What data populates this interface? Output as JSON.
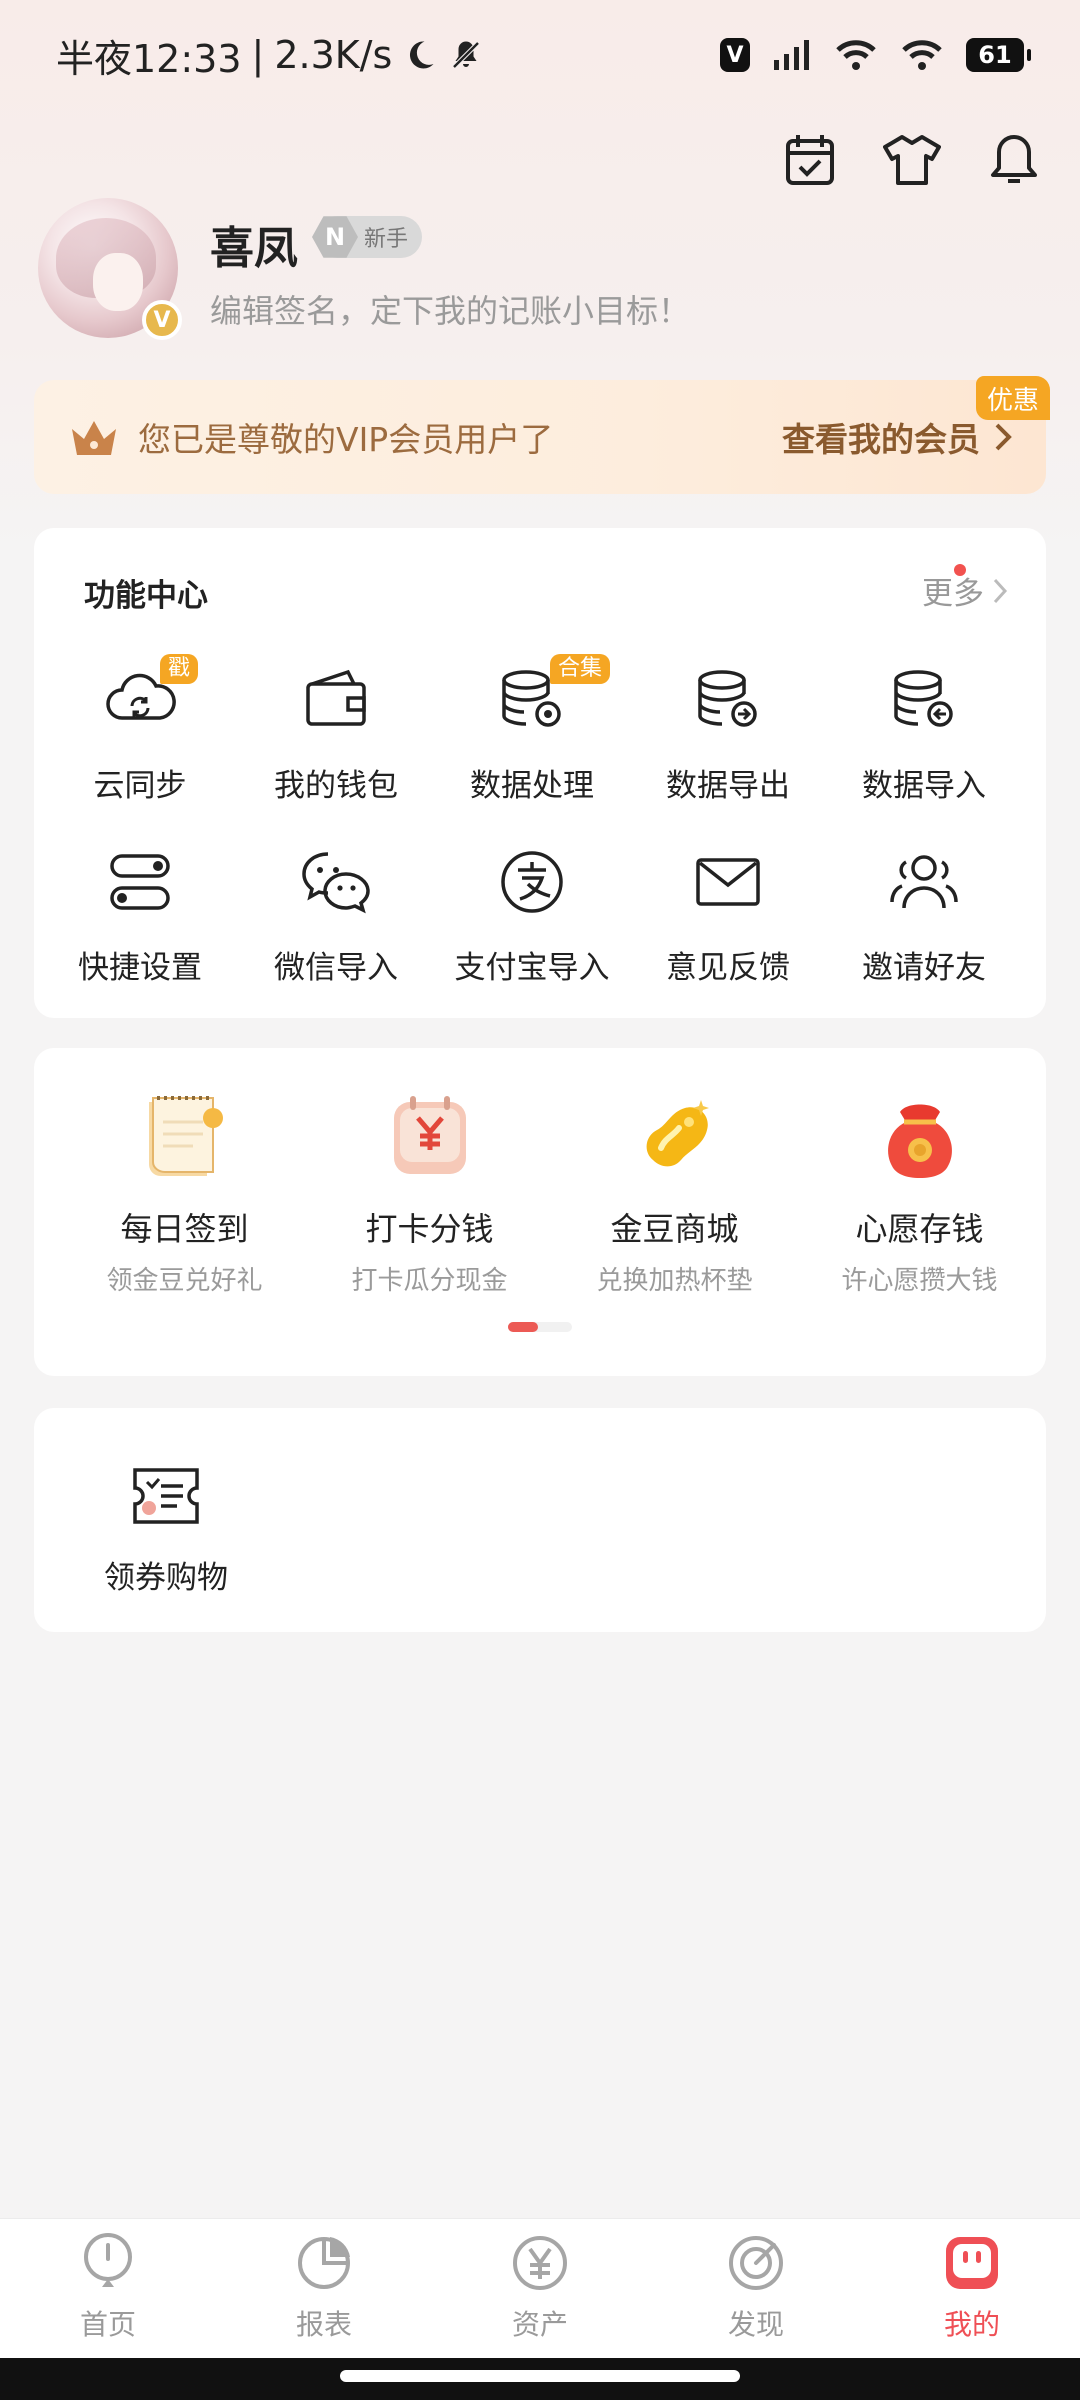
{
  "status_bar": {
    "time": "半夜12:33",
    "separator": "|",
    "speed": "2.3K/s",
    "vpn": "V",
    "battery": "61"
  },
  "header": {
    "icons": [
      "calendar-check-icon",
      "shirt-icon",
      "bell-icon"
    ]
  },
  "profile": {
    "username": "喜凤",
    "level_letter": "N",
    "level_label": "新手",
    "avatar_badge": "V",
    "signature": "编辑签名，定下我的记账小目标！"
  },
  "vip": {
    "text": "您已是尊敬的VIP会员用户了",
    "link": "查看我的会员",
    "promo_badge": "优惠",
    "accent": "#f5a623"
  },
  "function_center": {
    "title": "功能中心",
    "more": "更多",
    "items": [
      {
        "label": "云同步",
        "badge": "戳"
      },
      {
        "label": "我的钱包",
        "badge": ""
      },
      {
        "label": "数据处理",
        "badge": "合集"
      },
      {
        "label": "数据导出",
        "badge": ""
      },
      {
        "label": "数据导入",
        "badge": ""
      },
      {
        "label": "快捷设置",
        "badge": ""
      },
      {
        "label": "微信导入",
        "badge": ""
      },
      {
        "label": "支付宝导入",
        "badge": ""
      },
      {
        "label": "意见反馈",
        "badge": ""
      },
      {
        "label": "邀请好友",
        "badge": ""
      }
    ]
  },
  "activities": {
    "items": [
      {
        "label": "每日签到",
        "sub": "领金豆兑好礼"
      },
      {
        "label": "打卡分钱",
        "sub": "打卡瓜分现金"
      },
      {
        "label": "金豆商城",
        "sub": "兑换加热杯垫"
      },
      {
        "label": "心愿存钱",
        "sub": "许心愿攒大钱"
      }
    ]
  },
  "coupon": {
    "label": "领券购物"
  },
  "bottom_nav": {
    "items": [
      {
        "label": "首页"
      },
      {
        "label": "报表"
      },
      {
        "label": "资产"
      },
      {
        "label": "发现"
      },
      {
        "label": "我的"
      }
    ],
    "active_color": "#ef4f55"
  }
}
